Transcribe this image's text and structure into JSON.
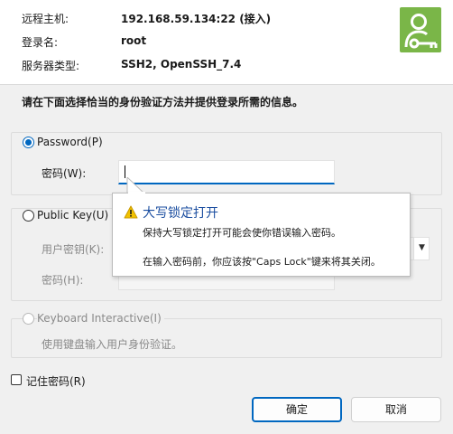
{
  "connection": {
    "host_label": "远程主机:",
    "host_value": "192.168.59.134:22 (接入)",
    "user_label": "登录名:",
    "user_value": "root",
    "server_label": "服务器类型:",
    "server_value": "SSH2, OpenSSH_7.4"
  },
  "prompt": "请在下面选择恰当的身份验证方法并提供登录所需的信息。",
  "password_method": {
    "label": "Password(P)",
    "checked": true,
    "field_label": "密码(W):",
    "field_value": ""
  },
  "publickey_method": {
    "label": "Public Key(U)",
    "checked": false,
    "key_label": "用户密钥(K):",
    "passphrase_label": "密码(H):"
  },
  "keyboard_method": {
    "label": "Keyboard Interactive(I)",
    "checked": false,
    "description": "使用键盘输入用户身份验证。"
  },
  "remember": {
    "label": "记住密码(R)",
    "checked": false
  },
  "buttons": {
    "ok": "确定",
    "cancel": "取消"
  },
  "capslock_tooltip": {
    "title": "大写锁定打开",
    "line1": "保持大写锁定打开可能会使你错误输入密码。",
    "line2": "在输入密码前，你应该按\"Caps Lock\"键来将其关闭。"
  },
  "colors": {
    "accent": "#0067c0",
    "logo": "#7ab648",
    "warning": "#f2c200",
    "tooltip_title": "#1b4ea0"
  },
  "icons": {
    "logo": "user-key-icon",
    "warning": "warning-icon"
  }
}
